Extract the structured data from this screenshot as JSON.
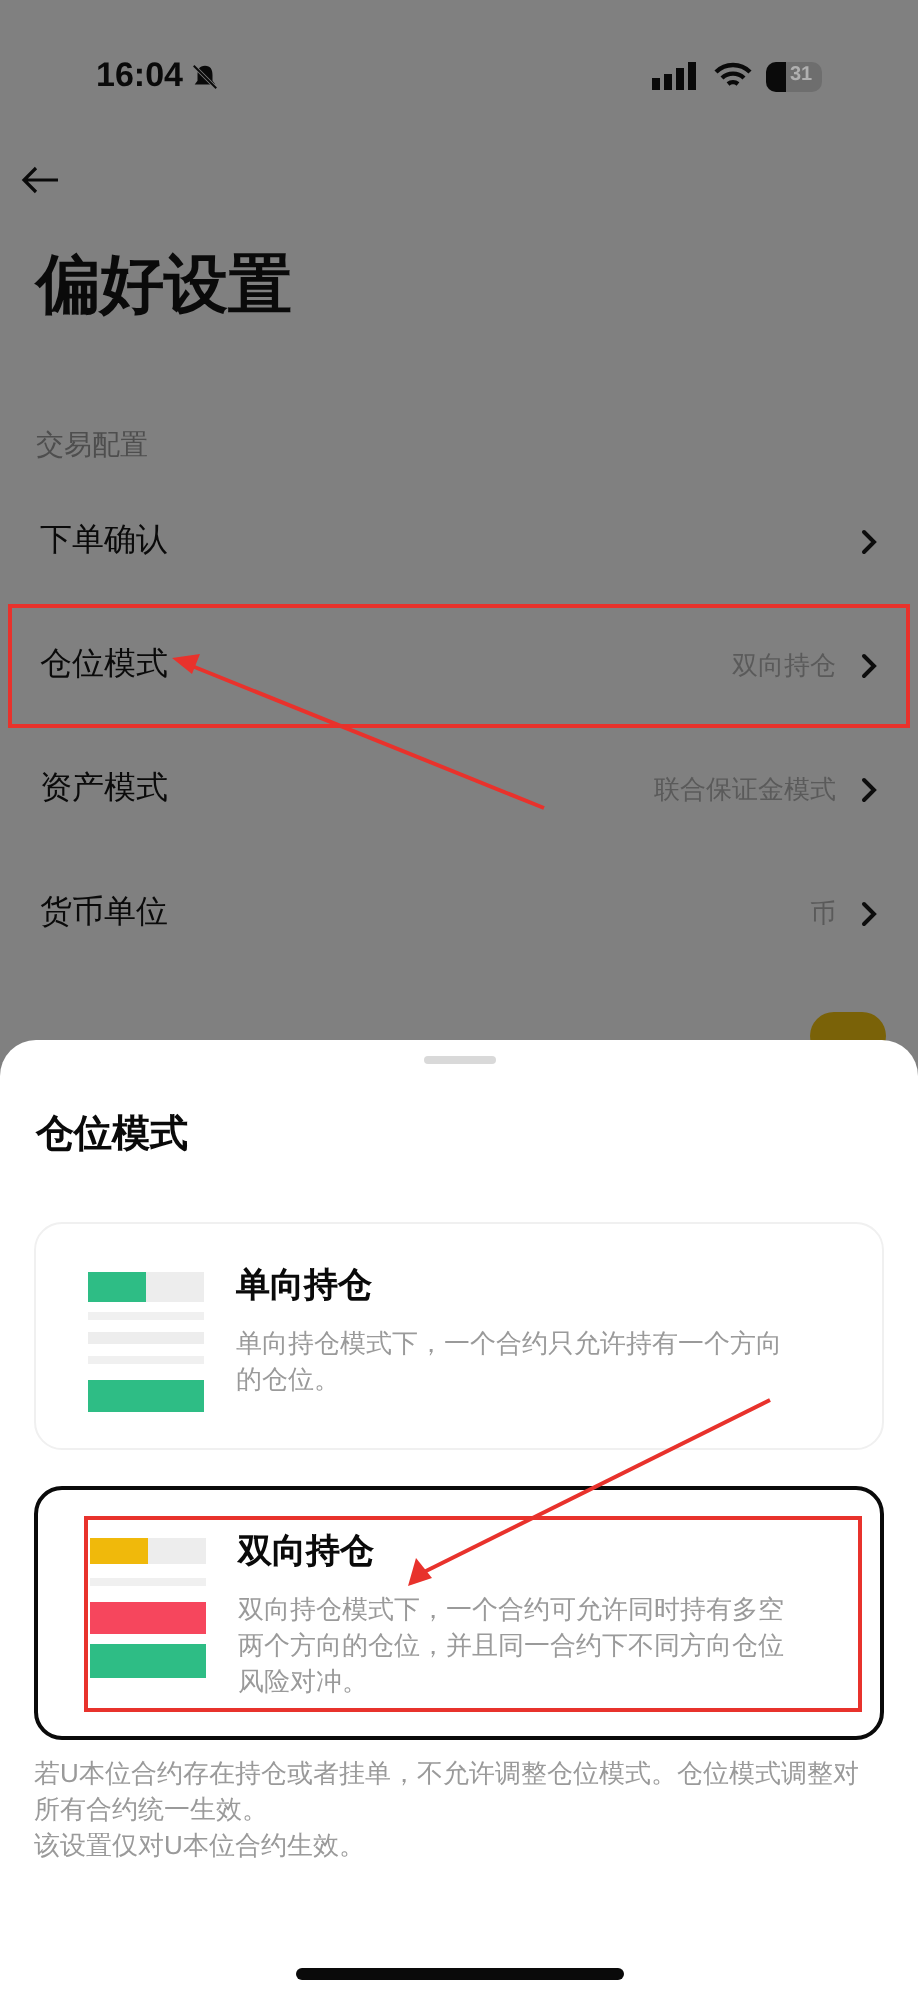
{
  "status_bar": {
    "time": "16:04",
    "battery": "31"
  },
  "header": {
    "title": "偏好设置"
  },
  "section": "交易配置",
  "rows": [
    {
      "label": "下单确认",
      "kind": "link",
      "annotated": false
    },
    {
      "label": "仓位模式",
      "value": "双向持仓",
      "kind": "link",
      "annotated": true
    },
    {
      "label": "资产模式",
      "value": "联合保证金模式",
      "kind": "link",
      "annotated": false
    },
    {
      "label": "货币单位",
      "value": "币",
      "kind": "link",
      "annotated": false
    }
  ],
  "covered_toggle": {
    "on": true
  },
  "sheet": {
    "title": "仓位模式",
    "options": [
      {
        "kind": "one_way",
        "title": "单向持仓",
        "description": "单向持仓模式下，一个合约只允许持有一个方向的仓位。",
        "selected": false,
        "annotated": false
      },
      {
        "kind": "hedge",
        "title": "双向持仓",
        "description": "双向持仓模式下，一个合约可允许同时持有多空两个方向的仓位，并且同一合约下不同方向仓位风险对冲。",
        "selected": true,
        "annotated": true
      }
    ],
    "notes": [
      "若U本位合约存在持仓或者挂单，不允许调整仓位模式。仓位模式调整对所有合约统一生效。",
      "该设置仅对U本位合约生效。"
    ]
  }
}
